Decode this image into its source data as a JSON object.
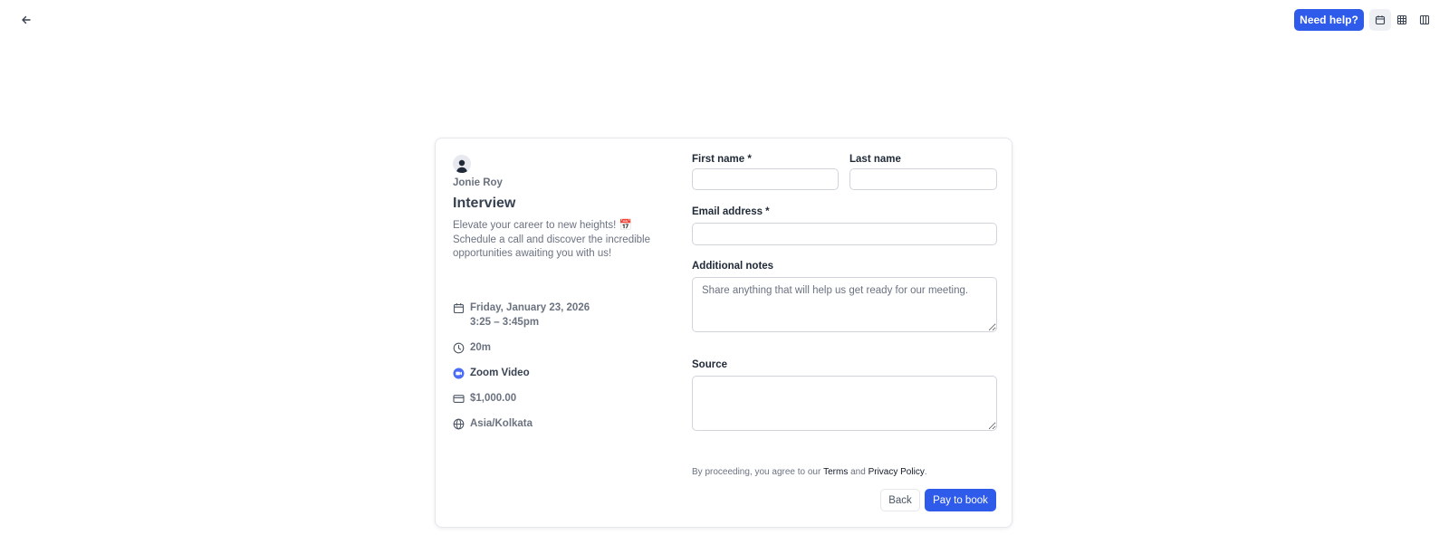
{
  "header": {
    "back_icon": "arrow-left-icon",
    "help_label": "Need help?",
    "views": [
      {
        "name": "month-view",
        "icon": "calendar-icon",
        "active": true
      },
      {
        "name": "week-view",
        "icon": "grid-icon",
        "active": false
      },
      {
        "name": "column-view",
        "icon": "columns-icon",
        "active": false
      }
    ]
  },
  "event": {
    "host_name": "Jonie Roy",
    "title": "Interview",
    "description": "Elevate your career to new heights! 📅 Schedule a call and discover the incredible opportunities awaiting you with us!",
    "date": "Friday, January 23, 2026",
    "time": "3:25 – 3:45pm",
    "duration": "20m",
    "location": "Zoom Video",
    "price": "$1,000.00",
    "timezone": "Asia/Kolkata"
  },
  "form": {
    "first_name_label": "First name *",
    "first_name_value": "",
    "last_name_label": "Last name",
    "last_name_value": "",
    "email_label": "Email address *",
    "email_value": "",
    "notes_label": "Additional notes",
    "notes_placeholder": "Share anything that will help us get ready for our meeting.",
    "source_label": "Source",
    "source_value": ""
  },
  "footer": {
    "terms_prefix": "By proceeding, you agree to our ",
    "terms_link": "Terms",
    "terms_and": " and ",
    "privacy_link": "Privacy Policy",
    "terms_suffix": ".",
    "back_label": "Back",
    "pay_label": "Pay to book"
  },
  "colors": {
    "brand": "#2f5bea",
    "zoom": "#4a6cf7"
  }
}
